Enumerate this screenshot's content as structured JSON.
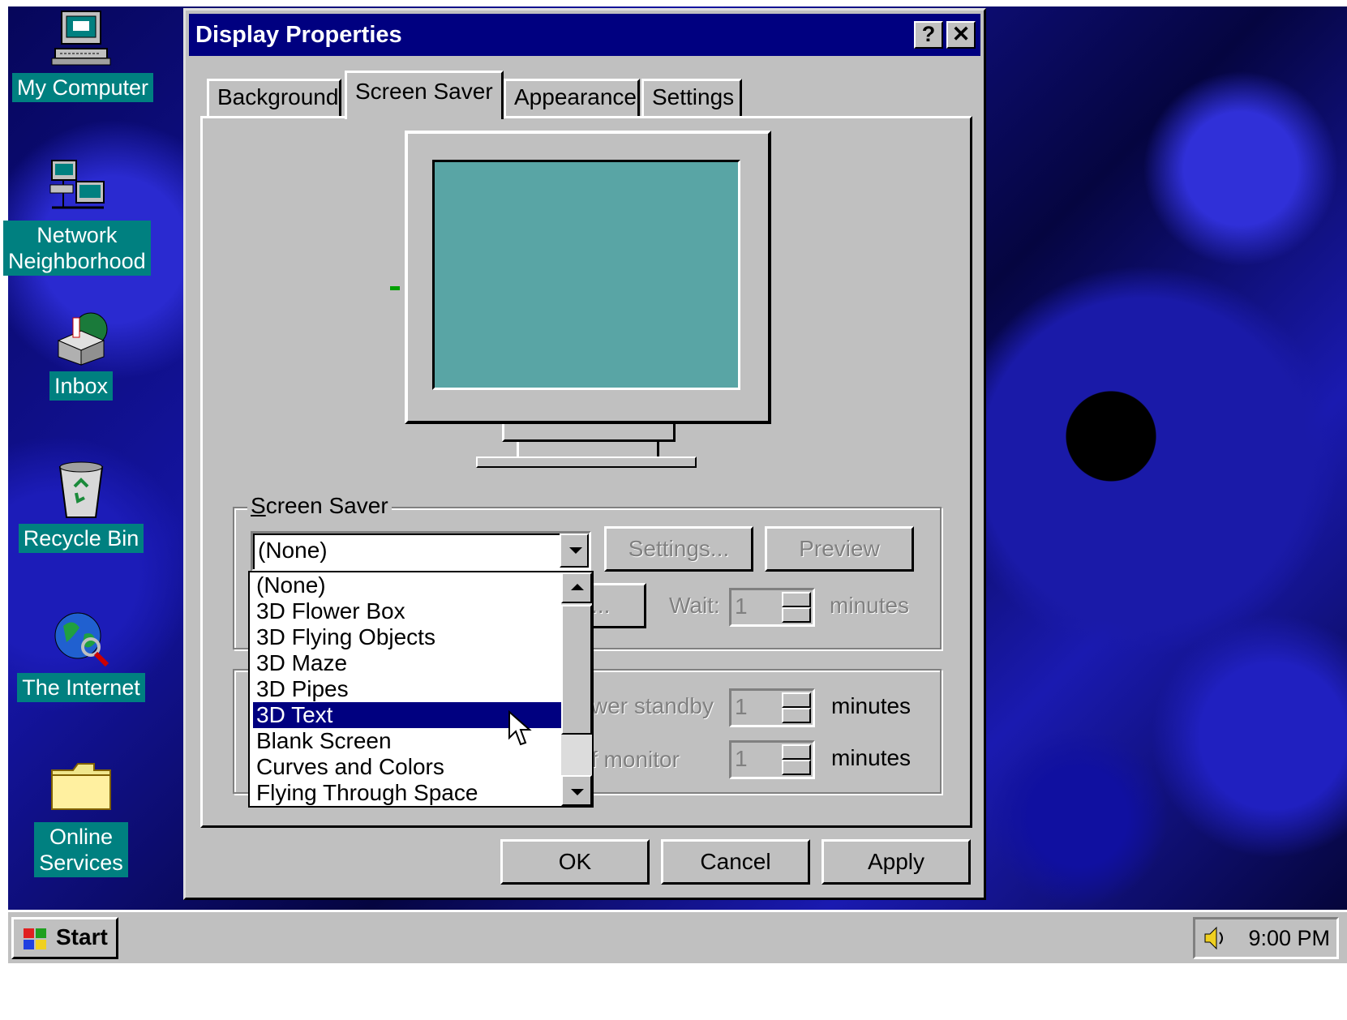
{
  "desktop": {
    "icons": [
      {
        "label": "My Computer",
        "icon": "my-computer-icon"
      },
      {
        "label": "Network\nNeighborhood",
        "icon": "network-neighborhood-icon"
      },
      {
        "label": "Inbox",
        "icon": "inbox-icon"
      },
      {
        "label": "Recycle Bin",
        "icon": "recycle-bin-icon"
      },
      {
        "label": "The Internet",
        "icon": "internet-icon"
      },
      {
        "label": "Online\nServices",
        "icon": "folder-icon"
      }
    ]
  },
  "dialog": {
    "title": "Display Properties",
    "help_button": "?",
    "close_button": "✕",
    "tabs": [
      "Background",
      "Screen Saver",
      "Appearance",
      "Settings"
    ],
    "active_tab": "Screen Saver",
    "screen_saver_group": {
      "legend_prefix": "S",
      "legend_rest": "creen Saver",
      "selected_value": "(None)",
      "settings_button": "Settings...",
      "preview_button": "Preview",
      "password_button_partial": "e...",
      "wait_label": "Wait:",
      "wait_value": "1",
      "wait_unit": "minutes"
    },
    "energy_group": {
      "standby_label_partial": "wer standby",
      "standby_value": "1",
      "standby_unit": "minutes",
      "shutoff_label_partial": "f monitor",
      "shutoff_value": "1",
      "shutoff_unit": "minutes"
    },
    "dropdown_options": [
      "(None)",
      "3D Flower Box",
      "3D Flying Objects",
      "3D Maze",
      "3D Pipes",
      "3D Text",
      "Blank Screen",
      "Curves and Colors",
      "Flying Through Space"
    ],
    "highlighted_option": "3D Text",
    "buttons": {
      "ok": "OK",
      "cancel": "Cancel",
      "apply": "Apply"
    }
  },
  "taskbar": {
    "start_label": "Start",
    "clock": "9:00 PM"
  },
  "colors": {
    "titlebar": "#000080",
    "dialog_face": "#c0c0c0",
    "preview_screen": "#59a5a5",
    "icon_label_bg": "#008080",
    "selection": "#000080"
  }
}
